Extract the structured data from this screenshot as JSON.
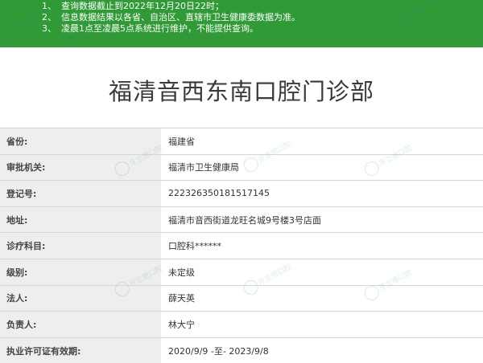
{
  "notice": {
    "lines": [
      {
        "num": "1、",
        "text": "查询数据截止到2022年12月20日22时；"
      },
      {
        "num": "2、",
        "text": "信息数据结果以各省、自治区、直辖市卫生健康委数据为准。"
      },
      {
        "num": "3、",
        "text": "凌晨1点至凌晨5点系统进行维护，不能提供查询。"
      }
    ]
  },
  "page_title": "福清音西东南口腔门诊部",
  "rows": [
    {
      "label": "省份:",
      "value": "福建省"
    },
    {
      "label": "审批机关:",
      "value": "福清市卫生健康局"
    },
    {
      "label": "登记号:",
      "value": "222326350181517145"
    },
    {
      "label": "地址:",
      "value": "福清市音西街道龙旺名城9号楼3号店面"
    },
    {
      "label": "诊疗科目:",
      "value": "口腔科******"
    },
    {
      "label": "级别:",
      "value": "未定级"
    },
    {
      "label": "法人:",
      "value": "薛天英"
    },
    {
      "label": "负责人:",
      "value": "林大宁"
    },
    {
      "label": "执业许可证有效期:",
      "value": "2020/9/9 -至- 2023/9/8"
    }
  ],
  "watermark": "牙立德口腔",
  "colors": {
    "notice_bg": "#2f9a36",
    "label_bg": "#eeeeee",
    "title_text": "#3a3a3a"
  }
}
